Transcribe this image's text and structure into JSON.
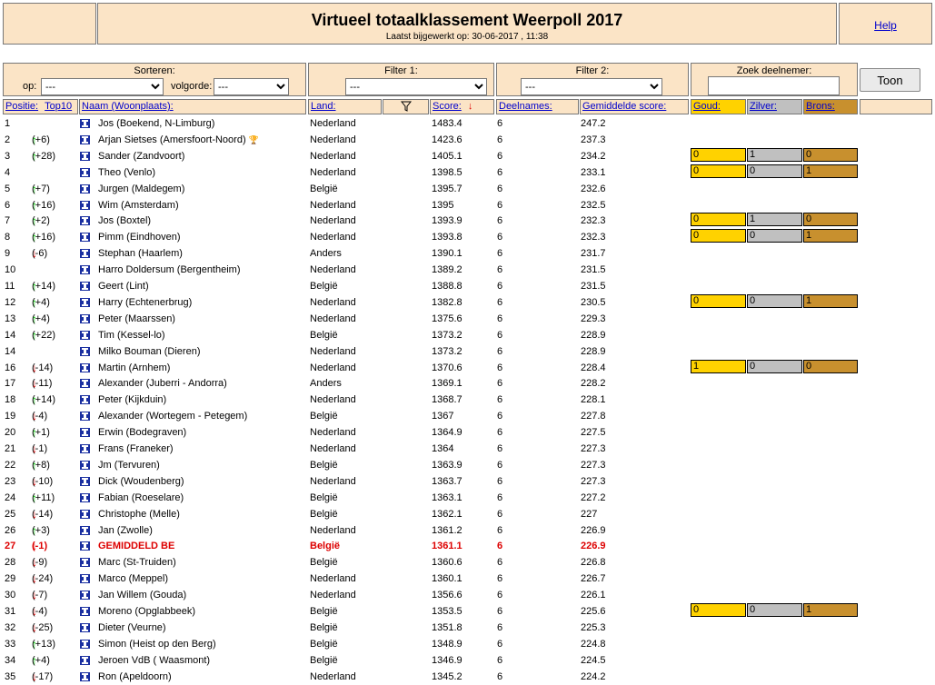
{
  "header": {
    "title": "Virtueel totaalklassement Weerpoll 2017",
    "updated": "Laatst bijgewerkt op: 30-06-2017 , 11:38",
    "help": "Help"
  },
  "controls": {
    "sort_label": "Sorteren:",
    "op_label": "op:",
    "op_value": "---",
    "volgorde_label": "volgorde:",
    "volgorde_value": "---",
    "filter1_label": "Filter 1:",
    "filter1_value": "---",
    "filter2_label": "Filter 2:",
    "filter2_value": "---",
    "search_label": "Zoek deelnemer:",
    "search_value": "",
    "button": "Toon"
  },
  "columns": {
    "positie": "Positie:",
    "top10": "Top10",
    "naam": "Naam (Woonplaats):",
    "land": "Land:",
    "score": "Score:",
    "deelnames": "Deelnames:",
    "gem": "Gemiddelde score:",
    "goud": "Goud:",
    "zilver": "Zilver:",
    "brons": "Brons:"
  },
  "colors": {
    "goud": "#ffd200",
    "zilver": "#c0c0c0",
    "brons": "#c8902e",
    "header_bg": "#fbe4c6",
    "highlight": "#dd0000"
  },
  "rows": [
    {
      "pos": "1",
      "dir": "",
      "chg": "",
      "name": "Jos (Boekend, N-Limburg)",
      "land": "Nederland",
      "score": "1483.4",
      "deel": "6",
      "gem": "247.2"
    },
    {
      "pos": "2",
      "dir": "up",
      "chg": "(+6)",
      "name": "Arjan Sietses (Amersfoort-Noord)",
      "trophy": true,
      "land": "Nederland",
      "score": "1423.6",
      "deel": "6",
      "gem": "237.3"
    },
    {
      "pos": "3",
      "dir": "up",
      "chg": "(+28)",
      "name": "Sander (Zandvoort)",
      "land": "Nederland",
      "score": "1405.1",
      "deel": "6",
      "gem": "234.2",
      "medals": [
        "0",
        "1",
        "0"
      ]
    },
    {
      "pos": "4",
      "dir": "",
      "chg": "",
      "name": "Theo (Venlo)",
      "land": "Nederland",
      "score": "1398.5",
      "deel": "6",
      "gem": "233.1",
      "medals": [
        "0",
        "0",
        "1"
      ]
    },
    {
      "pos": "5",
      "dir": "up",
      "chg": "(+7)",
      "name": "Jurgen (Maldegem)",
      "land": "België",
      "score": "1395.7",
      "deel": "6",
      "gem": "232.6"
    },
    {
      "pos": "6",
      "dir": "up",
      "chg": "(+16)",
      "name": "Wim (Amsterdam)",
      "land": "Nederland",
      "score": "1395",
      "deel": "6",
      "gem": "232.5"
    },
    {
      "pos": "7",
      "dir": "up",
      "chg": "(+2)",
      "name": "Jos (Boxtel)",
      "land": "Nederland",
      "score": "1393.9",
      "deel": "6",
      "gem": "232.3",
      "medals": [
        "0",
        "1",
        "0"
      ]
    },
    {
      "pos": "8",
      "dir": "up",
      "chg": "(+16)",
      "name": "Pimm (Eindhoven)",
      "land": "Nederland",
      "score": "1393.8",
      "deel": "6",
      "gem": "232.3",
      "medals": [
        "0",
        "0",
        "1"
      ]
    },
    {
      "pos": "9",
      "dir": "down",
      "chg": "(-6)",
      "name": "Stephan (Haarlem)",
      "land": "Anders",
      "score": "1390.1",
      "deel": "6",
      "gem": "231.7"
    },
    {
      "pos": "10",
      "dir": "",
      "chg": "",
      "name": "Harro Doldersum (Bergentheim)",
      "land": "Nederland",
      "score": "1389.2",
      "deel": "6",
      "gem": "231.5"
    },
    {
      "pos": "11",
      "dir": "up",
      "chg": "(+14)",
      "name": "Geert (Lint)",
      "land": "België",
      "score": "1388.8",
      "deel": "6",
      "gem": "231.5"
    },
    {
      "pos": "12",
      "dir": "up",
      "chg": "(+4)",
      "name": "Harry (Echtenerbrug)",
      "land": "Nederland",
      "score": "1382.8",
      "deel": "6",
      "gem": "230.5",
      "medals": [
        "0",
        "0",
        "1"
      ]
    },
    {
      "pos": "13",
      "dir": "up",
      "chg": "(+4)",
      "name": "Peter (Maarssen)",
      "land": "Nederland",
      "score": "1375.6",
      "deel": "6",
      "gem": "229.3"
    },
    {
      "pos": "14",
      "dir": "up",
      "chg": "(+22)",
      "name": "Tim (Kessel-lo)",
      "land": "België",
      "score": "1373.2",
      "deel": "6",
      "gem": "228.9"
    },
    {
      "pos": "14",
      "dir": "",
      "chg": "",
      "name": "Milko Bouman (Dieren)",
      "land": "Nederland",
      "score": "1373.2",
      "deel": "6",
      "gem": "228.9"
    },
    {
      "pos": "16",
      "dir": "down",
      "chg": "(-14)",
      "name": "Martin (Arnhem)",
      "land": "Nederland",
      "score": "1370.6",
      "deel": "6",
      "gem": "228.4",
      "medals": [
        "1",
        "0",
        "0"
      ]
    },
    {
      "pos": "17",
      "dir": "down",
      "chg": "(-11)",
      "name": "Alexander (Juberri - Andorra)",
      "land": "Anders",
      "score": "1369.1",
      "deel": "6",
      "gem": "228.2"
    },
    {
      "pos": "18",
      "dir": "up",
      "chg": "(+14)",
      "name": "Peter (Kijkduin)",
      "land": "Nederland",
      "score": "1368.7",
      "deel": "6",
      "gem": "228.1"
    },
    {
      "pos": "19",
      "dir": "down",
      "chg": "(-4)",
      "name": "Alexander (Wortegem - Petegem)",
      "land": "België",
      "score": "1367",
      "deel": "6",
      "gem": "227.8"
    },
    {
      "pos": "20",
      "dir": "up",
      "chg": "(+1)",
      "name": "Erwin (Bodegraven)",
      "land": "Nederland",
      "score": "1364.9",
      "deel": "6",
      "gem": "227.5"
    },
    {
      "pos": "21",
      "dir": "down",
      "chg": "(-1)",
      "name": "Frans (Franeker)",
      "land": "Nederland",
      "score": "1364",
      "deel": "6",
      "gem": "227.3"
    },
    {
      "pos": "22",
      "dir": "up",
      "chg": "(+8)",
      "name": "Jm (Tervuren)",
      "land": "België",
      "score": "1363.9",
      "deel": "6",
      "gem": "227.3"
    },
    {
      "pos": "23",
      "dir": "down",
      "chg": "(-10)",
      "name": "Dick (Woudenberg)",
      "land": "Nederland",
      "score": "1363.7",
      "deel": "6",
      "gem": "227.3"
    },
    {
      "pos": "24",
      "dir": "up",
      "chg": "(+11)",
      "name": "Fabian (Roeselare)",
      "land": "België",
      "score": "1363.1",
      "deel": "6",
      "gem": "227.2"
    },
    {
      "pos": "25",
      "dir": "down",
      "chg": "(-14)",
      "name": "Christophe (Melle)",
      "land": "België",
      "score": "1362.1",
      "deel": "6",
      "gem": "227"
    },
    {
      "pos": "26",
      "dir": "up",
      "chg": "(+3)",
      "name": "Jan (Zwolle)",
      "land": "Nederland",
      "score": "1361.2",
      "deel": "6",
      "gem": "226.9"
    },
    {
      "pos": "27",
      "dir": "down",
      "chg": "(-1)",
      "name": "GEMIDDELD BE",
      "land": "België",
      "score": "1361.1",
      "deel": "6",
      "gem": "226.9",
      "highlight": true
    },
    {
      "pos": "28",
      "dir": "down",
      "chg": "(-9)",
      "name": "Marc (St-Truiden)",
      "land": "België",
      "score": "1360.6",
      "deel": "6",
      "gem": "226.8"
    },
    {
      "pos": "29",
      "dir": "down",
      "chg": "(-24)",
      "name": "Marco (Meppel)",
      "land": "Nederland",
      "score": "1360.1",
      "deel": "6",
      "gem": "226.7"
    },
    {
      "pos": "30",
      "dir": "down",
      "chg": "(-7)",
      "name": "Jan Willem (Gouda)",
      "land": "Nederland",
      "score": "1356.6",
      "deel": "6",
      "gem": "226.1"
    },
    {
      "pos": "31",
      "dir": "down",
      "chg": "(-4)",
      "name": "Moreno (Opglabbeek)",
      "land": "België",
      "score": "1353.5",
      "deel": "6",
      "gem": "225.6",
      "medals": [
        "0",
        "0",
        "1"
      ]
    },
    {
      "pos": "32",
      "dir": "down",
      "chg": "(-25)",
      "name": "Dieter (Veurne)",
      "land": "België",
      "score": "1351.8",
      "deel": "6",
      "gem": "225.3"
    },
    {
      "pos": "33",
      "dir": "up",
      "chg": "(+13)",
      "name": "Simon (Heist op den Berg)",
      "land": "België",
      "score": "1348.9",
      "deel": "6",
      "gem": "224.8"
    },
    {
      "pos": "34",
      "dir": "up",
      "chg": "(+4)",
      "name": "Jeroen VdB ( Waasmont)",
      "land": "België",
      "score": "1346.9",
      "deel": "6",
      "gem": "224.5"
    },
    {
      "pos": "35",
      "dir": "down",
      "chg": "(-17)",
      "name": "Ron (Apeldoorn)",
      "land": "Nederland",
      "score": "1345.2",
      "deel": "6",
      "gem": "224.2"
    }
  ]
}
